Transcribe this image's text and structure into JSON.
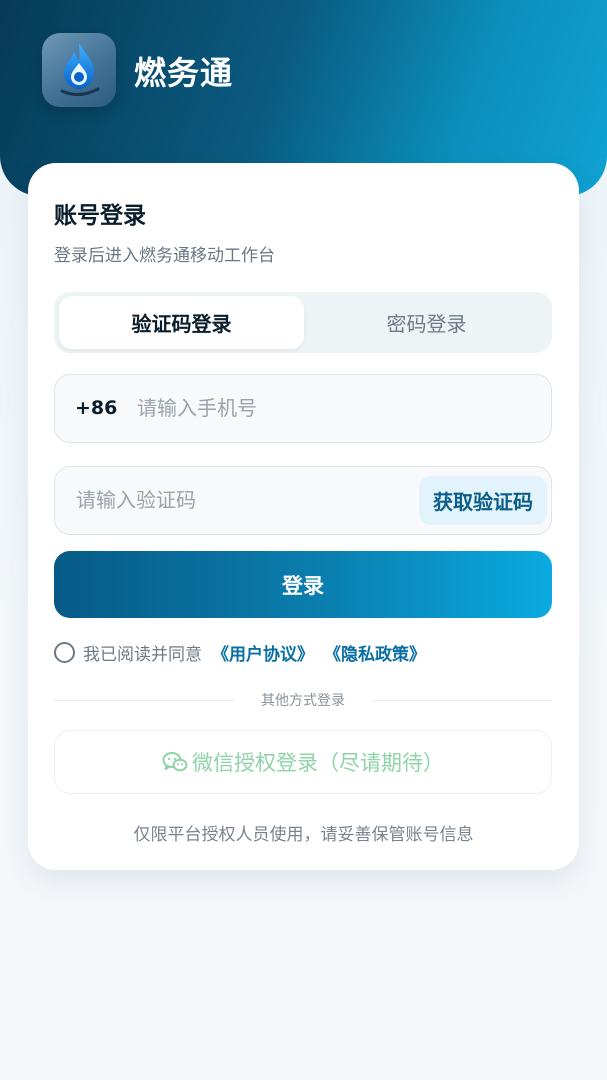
{
  "app": {
    "name": "燃务通",
    "icon": "gas-flame-logo-icon"
  },
  "card": {
    "title": "账号登录",
    "subtitle": "登录后进入燃务通移动工作台"
  },
  "tabs": [
    {
      "label": "验证码登录",
      "active": true
    },
    {
      "label": "密码登录",
      "active": false
    }
  ],
  "phone": {
    "prefix": "+86",
    "placeholder": "请输入手机号",
    "value": ""
  },
  "code": {
    "placeholder": "请输入验证码",
    "value": "",
    "get_code_label": "获取验证码"
  },
  "login_button": "登录",
  "agreement": {
    "checked": false,
    "text": "我已阅读并同意",
    "user_agreement": "《用户协议》",
    "privacy_policy": "《隐私政策》"
  },
  "other_methods_label": "其他方式登录",
  "wechat": {
    "icon": "wechat-icon",
    "label": "微信授权登录（尽请期待）"
  },
  "footer_note": "仅限平台授权人员使用，请妥善保管账号信息",
  "colors": {
    "header_dark": "#063a57",
    "header_light": "#10a2d2",
    "primary": "#0a7fb0",
    "link": "#0a6fa3",
    "wechat_green": "#8fd3a8"
  }
}
